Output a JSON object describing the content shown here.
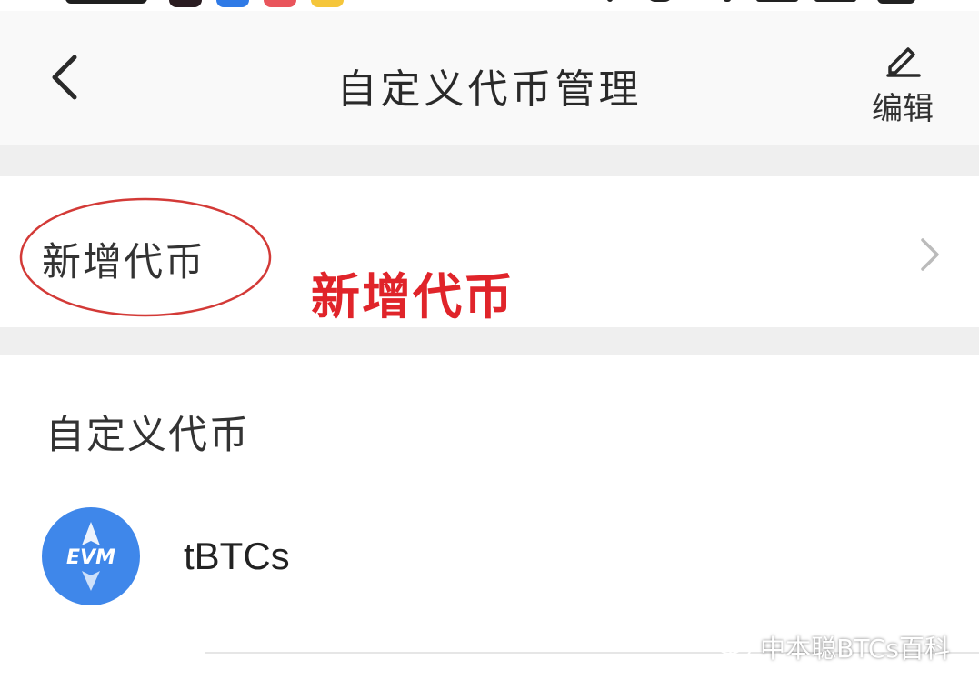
{
  "header": {
    "title": "自定义代币管理",
    "edit_label": "编辑"
  },
  "add_row": {
    "label": "新增代币",
    "annotation": "新增代币"
  },
  "custom_tokens": {
    "section_title": "自定义代币",
    "items": [
      {
        "logo_text": "EVM",
        "name": "tBTCs"
      }
    ]
  },
  "watermark": {
    "text": "中本聪BTCs百科"
  },
  "colors": {
    "annotation_red": "#e0242a",
    "token_logo_blue": "#3f87ea",
    "page_background": "#f4f4f4"
  },
  "icons": {
    "back": "chevron-left-icon",
    "edit": "pencil-icon",
    "row_arrow": "chevron-right-icon",
    "watermark": "wechat-icon"
  }
}
